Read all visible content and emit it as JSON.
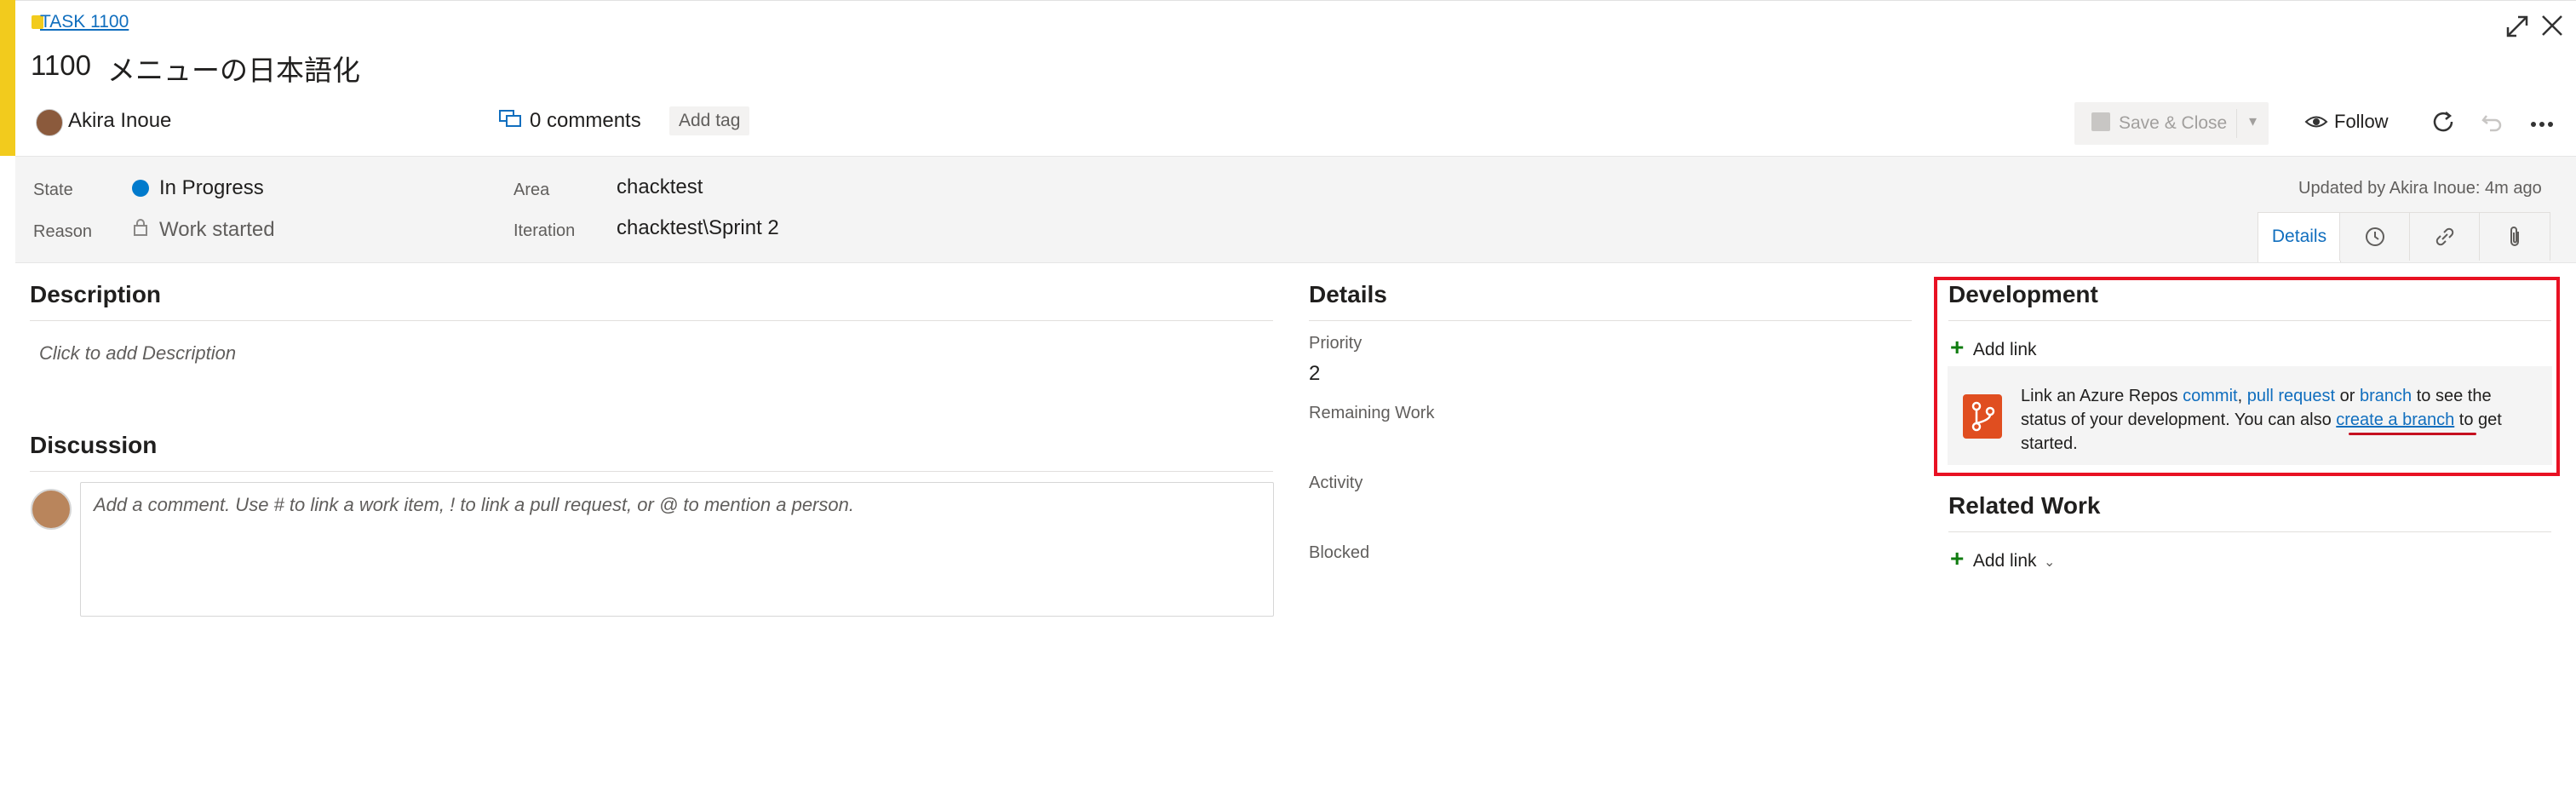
{
  "header": {
    "task_link": "TASK 1100",
    "work_item_id": "1100",
    "work_item_title": "メニューの日本語化",
    "author": "Akira Inoue",
    "comments_label": "0 comments",
    "add_tag": "Add tag",
    "save_close": "Save & Close",
    "follow": "Follow",
    "icons": {
      "expand": "expand-icon",
      "close": "close-icon",
      "refresh": "refresh-icon",
      "undo": "undo-icon",
      "more": "more-icon"
    }
  },
  "fields": {
    "state_label": "State",
    "state_value": "In Progress",
    "reason_label": "Reason",
    "reason_value": "Work started",
    "area_label": "Area",
    "area_value": "chacktest",
    "iteration_label": "Iteration",
    "iteration_value": "chacktest\\Sprint 2",
    "updated_text": "Updated by Akira Inoue: 4m ago"
  },
  "tabs": {
    "details": "Details",
    "history_icon": "history-icon",
    "links_icon": "link-icon",
    "attachments_icon": "attachment-icon"
  },
  "left": {
    "description_title": "Description",
    "description_placeholder": "Click to add Description",
    "discussion_title": "Discussion",
    "comment_placeholder": "Add a comment. Use # to link a work item, ! to link a pull request, or @ to mention a person."
  },
  "details": {
    "title": "Details",
    "priority_label": "Priority",
    "priority_value": "2",
    "remaining_work_label": "Remaining Work",
    "activity_label": "Activity",
    "blocked_label": "Blocked"
  },
  "development": {
    "title": "Development",
    "add_link": "Add link",
    "text_1": "Link an Azure Repos ",
    "commit": "commit",
    "comma": ", ",
    "pull_request": "pull request",
    "or": " or ",
    "branch": "branch",
    "text_2": " to see the status of your development. You can also ",
    "create_branch": "create a branch",
    "text_3": " to get started."
  },
  "related_work": {
    "title": "Related Work",
    "add_link": "Add link"
  },
  "colors": {
    "stripe": "#f2cb1d",
    "accent": "#106ebe",
    "state_dot": "#007acc",
    "highlight": "#e81123",
    "add": "#107c10"
  }
}
